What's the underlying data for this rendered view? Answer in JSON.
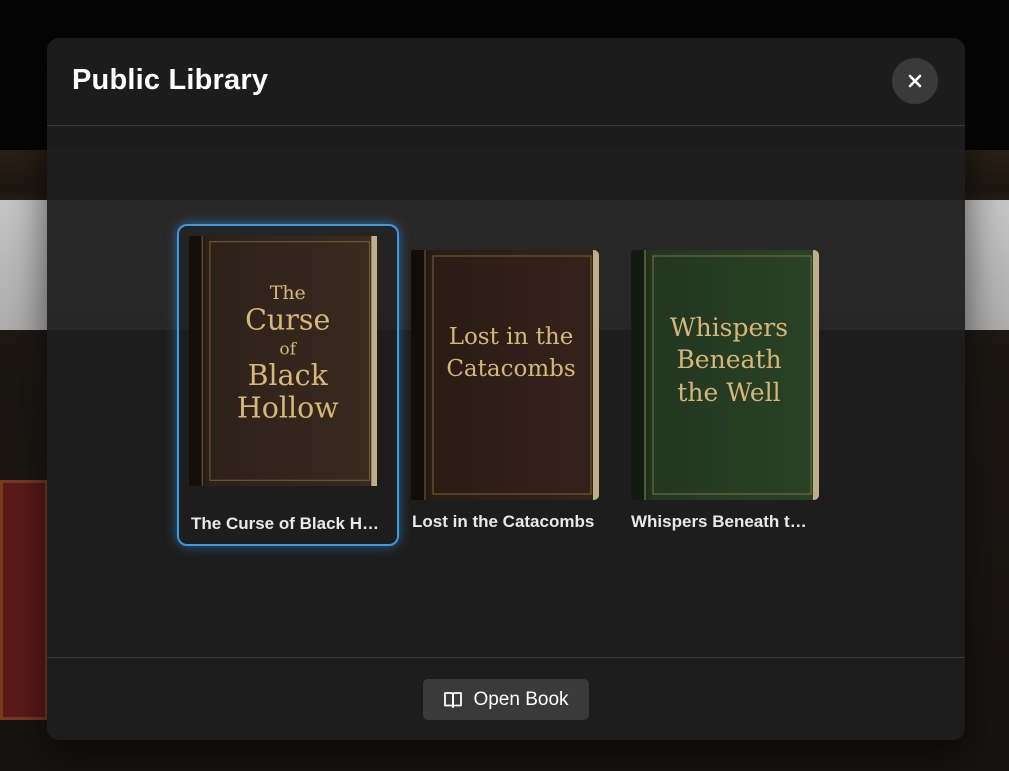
{
  "modal": {
    "title": "Public Library",
    "close_icon": "close-icon"
  },
  "books": [
    {
      "label": "The Curse of Black Hollow",
      "cover_lines": [
        "The",
        "Curse",
        "of",
        "Black",
        "Hollow"
      ],
      "cover_color": "#2e2119",
      "selected": true
    },
    {
      "label": "Lost in the Catacombs",
      "cover_lines": [
        "Lost in the",
        "Catacombs"
      ],
      "cover_color": "#2c1c16",
      "selected": false
    },
    {
      "label": "Whispers Beneath the Well",
      "cover_lines": [
        "Whispers",
        "Beneath",
        "the Well"
      ],
      "cover_color": "#263a24",
      "selected": false
    }
  ],
  "footer": {
    "open_button_label": "Open Book",
    "open_button_icon": "open-book-icon"
  },
  "colors": {
    "selection_accent": "#3a9be6",
    "gold_text": "#d6b77a"
  }
}
